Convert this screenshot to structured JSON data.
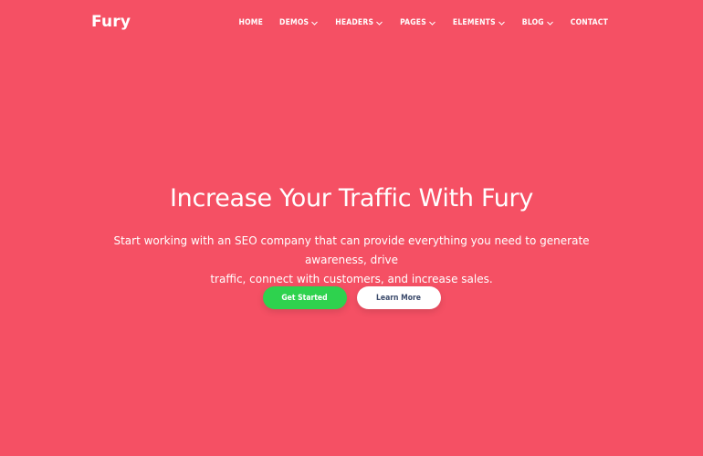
{
  "brand": {
    "name": "Fury"
  },
  "nav": {
    "items": [
      {
        "label": "HOME",
        "dropdown": false
      },
      {
        "label": "DEMOS",
        "dropdown": true
      },
      {
        "label": "HEADERS",
        "dropdown": true
      },
      {
        "label": "PAGES",
        "dropdown": true
      },
      {
        "label": "ELEMENTS",
        "dropdown": true
      },
      {
        "label": "BLOG",
        "dropdown": true
      },
      {
        "label": "CONTACT",
        "dropdown": false
      }
    ]
  },
  "hero": {
    "title": "Increase Your Traffic With Fury",
    "subtitle_line1": "Start working with an SEO company that can provide everything you need to generate awareness, drive",
    "subtitle_line2": "traffic, connect with customers, and increase sales.",
    "primary_button": "Get Started",
    "secondary_button": "Learn More"
  },
  "colors": {
    "background": "#f55064",
    "primary_button": "#2ed24e",
    "secondary_button": "#ffffff",
    "secondary_button_text": "#3b4a6b"
  }
}
